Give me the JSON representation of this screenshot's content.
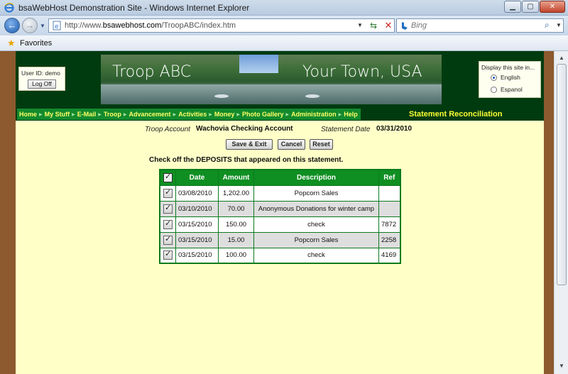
{
  "browser": {
    "window_title": "bsaWebHost Demonstration Site - Windows Internet Explorer",
    "url_prefix": "http://www.",
    "url_domain": "bsawebhost.com",
    "url_path": "/TroopABC/index.htm",
    "search_placeholder": "Bing",
    "favorites_label": "Favorites"
  },
  "header": {
    "user_id_text": "User ID: demo",
    "logoff_label": "Log Off",
    "banner_title_left": "Troop ABC",
    "banner_title_right": "Your Town, USA",
    "language": {
      "title": "Display this site in...",
      "options": [
        "English",
        "Espanol"
      ],
      "selected": "English"
    }
  },
  "nav": {
    "items": [
      "Home",
      "My Stuff",
      "E-Mail",
      "Troop",
      "Advancement",
      "Activities",
      "Money",
      "Photo Gallery",
      "Administration",
      "Help"
    ],
    "page_title": "Statement Reconciliation"
  },
  "statement": {
    "account_label": "Troop Account",
    "account_value": "Wachovia Checking Account",
    "date_label": "Statement Date",
    "date_value": "03/31/2010"
  },
  "actions": {
    "save_exit": "Save & Exit",
    "cancel": "Cancel",
    "reset": "Reset"
  },
  "instruction": "Check off the DEPOSITS that appeared on this statement.",
  "table": {
    "headers": [
      "",
      "Date",
      "Amount",
      "Description",
      "Ref"
    ],
    "rows": [
      {
        "checked": true,
        "date": "03/08/2010",
        "amount": "1,202.00",
        "description": "Popcorn Sales",
        "ref": ""
      },
      {
        "checked": true,
        "date": "03/10/2010",
        "amount": "70.00",
        "description": "Anonymous Donations for winter camp",
        "ref": ""
      },
      {
        "checked": true,
        "date": "03/15/2010",
        "amount": "150.00",
        "description": "check",
        "ref": "7872"
      },
      {
        "checked": true,
        "date": "03/15/2010",
        "amount": "15.00",
        "description": "Popcorn Sales",
        "ref": "2258"
      },
      {
        "checked": true,
        "date": "03/15/2010",
        "amount": "100.00",
        "description": "check",
        "ref": "4169"
      }
    ]
  },
  "colors": {
    "page_background": "#ffffc8",
    "header_green": "#003b10",
    "table_header": "#0f8f22",
    "nav_text": "#ffff66"
  }
}
